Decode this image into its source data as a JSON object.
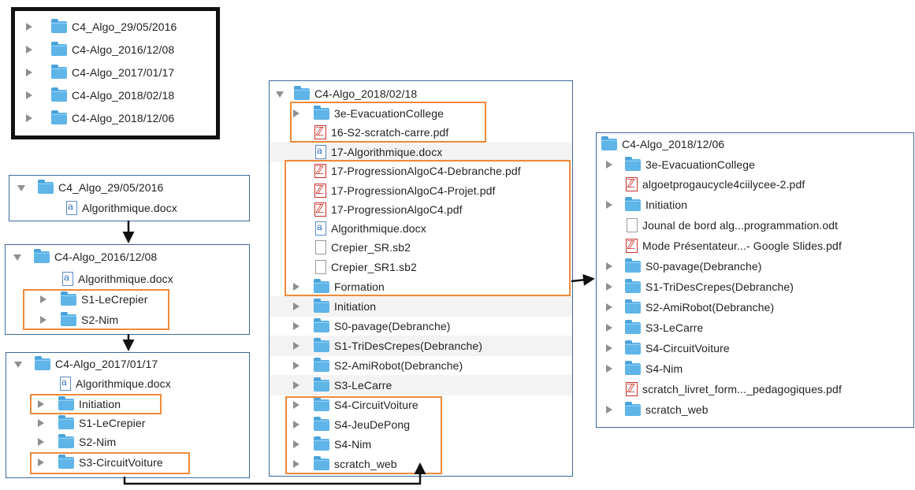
{
  "p1": {
    "items": [
      {
        "name": "C4_Algo_29/05/2016"
      },
      {
        "name": "C4-Algo_2016/12/08"
      },
      {
        "name": "C4-Algo_2017/01/17"
      },
      {
        "name": "C4-Algo_2018/02/18"
      },
      {
        "name": "C4-Algo_2018/12/06"
      }
    ]
  },
  "p2": {
    "title": "C4_Algo_29/05/2016",
    "files": [
      "Algorithmique.docx"
    ]
  },
  "p3": {
    "title": "C4-Algo_2016/12/08",
    "files": [
      "Algorithmique.docx",
      "S1-LeCrepier",
      "S2-Nim"
    ]
  },
  "p4": {
    "title": "C4-Algo_2017/01/17",
    "files": [
      "Algorithmique.docx",
      "Initiation",
      "S1-LeCrepier",
      "S2-Nim",
      "S3-CircuitVoiture"
    ]
  },
  "p5": {
    "title": "C4-Algo_2018/02/18",
    "files": [
      "3e-EvacuationCollege",
      "16-S2-scratch-carre.pdf",
      "17-Algorithmique.docx",
      "17-ProgressionAlgoC4-Debranche.pdf",
      "17-ProgressionAlgoC4-Projet.pdf",
      "17-ProgressionAlgoC4.pdf",
      "Algorithmique.docx",
      "Crepier_SR.sb2",
      "Crepier_SR1.sb2",
      "Formation",
      "Initiation",
      "S0-pavage(Debranche)",
      "S1-TriDesCrepes(Debranche)",
      "S2-AmiRobot(Debranche)",
      "S3-LeCarre",
      "S4-CircuitVoiture",
      "S4-JeuDePong",
      "S4-Nim",
      "scratch_web"
    ]
  },
  "p6": {
    "title": "C4-Algo_2018/12/06",
    "files": [
      "3e-EvacuationCollege",
      "algoetprogaucycle4ciilycee-2.pdf",
      "Initiation",
      "Jounal de bord alg...programmation.odt",
      "Mode Présentateur...- Google Slides.pdf",
      "S0-pavage(Debranche)",
      "S1-TriDesCrepes(Debranche)",
      "S2-AmiRobot(Debranche)",
      "S3-LeCarre",
      "S4-CircuitVoiture",
      "S4-Nim",
      "scratch_livret_form..._pedagogiques.pdf",
      "scratch_web"
    ]
  },
  "colors": {
    "folder": "#5fb4e8",
    "highlight": "#ef8a3a",
    "border": "#3d6a9c",
    "pdf": "#cc2a25"
  },
  "icons": [
    "folder-icon",
    "disclosure-triangle-icon",
    "word-doc-icon",
    "pdf-icon",
    "file-icon"
  ]
}
